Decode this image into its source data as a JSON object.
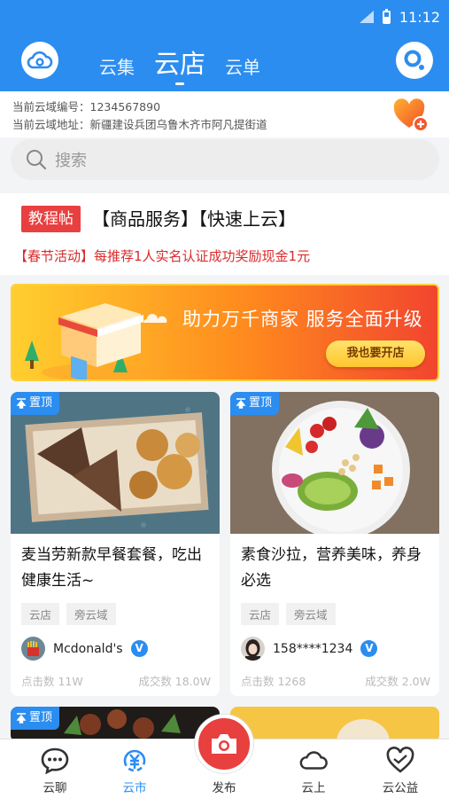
{
  "status_bar": {
    "time": "11:12"
  },
  "header": {
    "tabs": [
      {
        "label": "云集",
        "active": false
      },
      {
        "label": "云店",
        "active": true
      },
      {
        "label": "云单",
        "active": false
      }
    ]
  },
  "area_info": {
    "code_label": "当前云域编号：",
    "code_value": "1234567890",
    "address_label": "当前云域地址：",
    "address_value": "新疆建设兵团乌鲁木齐市阿凡提街道"
  },
  "search": {
    "placeholder": "搜索"
  },
  "notice": {
    "tag": "教程帖",
    "title": "【商品服务】【快速上云】",
    "promo": "【春节活动】每推荐1人实名认证成功奖励现金1元"
  },
  "banner": {
    "text": "助力万千商家  服务全面升级",
    "button": "我也要开店"
  },
  "cards": [
    {
      "pin": "置顶",
      "title": "麦当劳新款早餐套餐，吃出健康生活~",
      "tags": [
        "云店",
        "旁云域"
      ],
      "author": "Mcdonald's",
      "verified": "V",
      "clicks": "点击数 11W",
      "deals": "成交数 18.0W"
    },
    {
      "pin": "置顶",
      "title": "素食沙拉，营养美味，养身必选",
      "tags": [
        "云店",
        "旁云域"
      ],
      "author": "158****1234",
      "verified": "V",
      "clicks": "点击数 1268",
      "deals": "成交数 2.0W"
    },
    {
      "pin": "置顶"
    }
  ],
  "bottom_nav": {
    "items": [
      {
        "label": "云聊",
        "icon": "chat-icon"
      },
      {
        "label": "云市",
        "icon": "yen-icon",
        "active": true
      },
      {
        "label": "发布",
        "icon": "camera-icon"
      },
      {
        "label": "云上",
        "icon": "cloud-icon"
      },
      {
        "label": "云公益",
        "icon": "charity-heart-icon"
      }
    ]
  },
  "colors": {
    "primary": "#2b8df0",
    "accent_red": "#e84040",
    "promo_red": "#d92b2b"
  }
}
